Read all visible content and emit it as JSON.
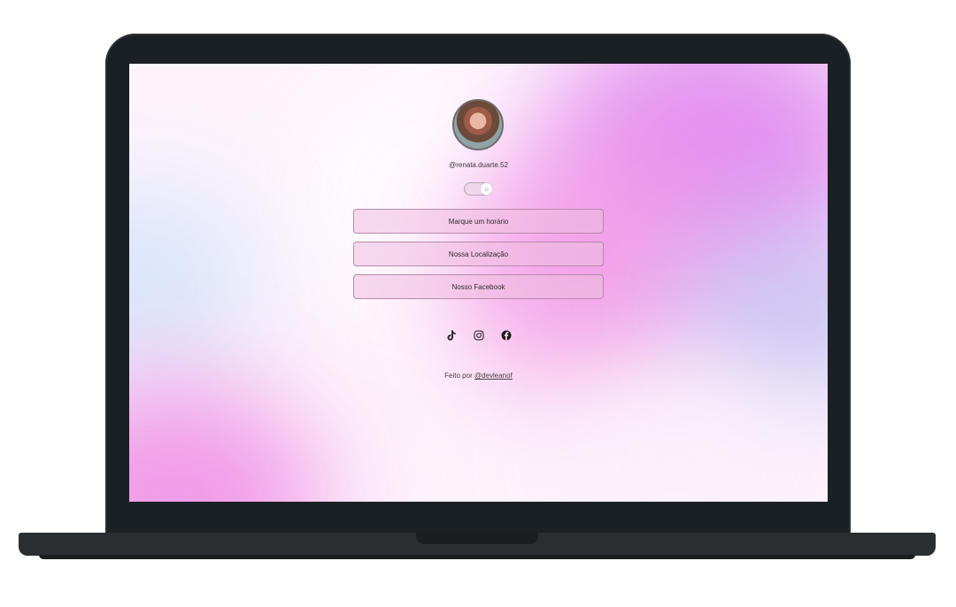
{
  "profile": {
    "handle": "@renata.duarte.52"
  },
  "theme_toggle": {
    "icon": "sun-icon",
    "state": "light"
  },
  "links": [
    {
      "label": "Marque um horário"
    },
    {
      "label": "Nossa Localização"
    },
    {
      "label": "Nosso Facebook"
    }
  ],
  "socials": [
    {
      "icon": "tiktok-icon"
    },
    {
      "icon": "instagram-icon"
    },
    {
      "icon": "facebook-icon"
    }
  ],
  "footer": {
    "prefix": "Feito por",
    "author": "@devleanof"
  },
  "colors": {
    "accent_pink": "#f39ae6",
    "accent_violet": "#e28ef0",
    "frame": "#1b2025"
  }
}
